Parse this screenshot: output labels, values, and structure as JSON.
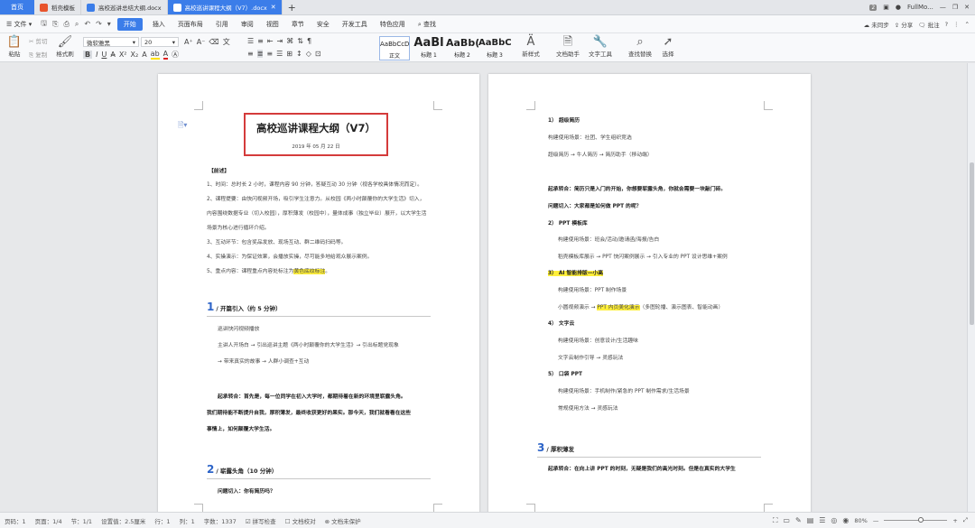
{
  "tabs": {
    "home": "首页",
    "t1": "稻壳模板",
    "t2": "高校巡讲总结大纲.docx",
    "t3": "高校巡讲课程大纲（V7）.docx",
    "badge": "2",
    "user": "FullMo..."
  },
  "menu": {
    "file": "文件",
    "start": "开始",
    "items": [
      "插入",
      "页面布局",
      "引用",
      "审阅",
      "视图",
      "章节",
      "安全",
      "开发工具",
      "特色应用"
    ],
    "search": "查找",
    "unsync": "未同步",
    "share": "分享",
    "comment": "批注"
  },
  "ribbon": {
    "paste": "粘贴",
    "cut": "剪切",
    "copy": "复制",
    "format_painter": "格式刷",
    "font": "微软雅黑",
    "size": "20",
    "styles": [
      {
        "preview": "AaBbCcDd",
        "name": "正文"
      },
      {
        "preview": "AaBl",
        "name": "标题 1"
      },
      {
        "preview": "AaBb(",
        "name": "标题 2"
      },
      {
        "preview": "AaBbC",
        "name": "标题 3"
      }
    ],
    "new_style": "新样式",
    "doc_helper": "文档助手",
    "text_tools": "文字工具",
    "find_replace": "查找替换",
    "select": "选择"
  },
  "page1": {
    "title": "高校巡讲课程大纲（V7）",
    "date": "2019 年 05 月 22 日",
    "note_head": "【前述】",
    "notes": [
      "1、时间：总时长 2 小时，课程内容 90 分钟，答疑互动 30 分钟（视各学校具体情况而定）。",
      "2、课程提要：由快闪视频开场，吸引学生注意力。从校园《两小时颠覆你的大学生活》切入，",
      "内容围绕数据专业（切入校园），厚积薄发（校园中），量体成事（独立毕业）展开，以大学生活",
      "场景为核心进行循环介绍。",
      "3、互动环节：包含奖品发放、现场互动、群二维码扫码等。",
      "4、实操演示：为保证效果，会播放实操，尽可能多地给观众展示案例。",
      "5、重点内容：课程重点内容处标注为"
    ],
    "notes_hl": "黄色底纹标注",
    "notes_end": "。",
    "sec1_num": "1",
    "sec1_title": "/ 开篇引入（约 5 分钟）",
    "sec1_lines": [
      "巡讲快闪视频播放",
      "主讲人开场白 → 引出巡讲主题《两小时颠覆你的大学生活》→ 引出标题党现象",
      "→ 带来真实的故事 → 人群小调查+互动"
    ],
    "trans1": [
      "起承转合：首先是，每一位同学在初入大学时，都期待着在新的环境里崭露头角。",
      "我们期待能不断提升自我，厚积薄发，最终收获更好的果实。那今天，我们就看看在这些",
      "事情上，如何颠覆大学生活。"
    ],
    "sec2_num": "2",
    "sec2_title": "/ 崭露头角（10 分钟）",
    "sec2_line": "问题切入：你有简历吗？"
  },
  "page2": {
    "items": [
      {
        "t": "1） 超级简历",
        "b": true
      },
      {
        "t": "构建使用场景：社团、学生组织竞选"
      },
      {
        "t": "超级简历 → 牛人简历 → 简历助手（移动端）"
      },
      {
        "t": "起承转合：简历只是入门的开始，你想要崭露头角，你就会需要一块敲门砖。",
        "b": true,
        "gap": true
      },
      {
        "t": "问题切入：大家都是如何做 PPT 的呢？",
        "b": true
      },
      {
        "t": "2） PPT 模板库",
        "b": true
      },
      {
        "t": "构建使用场景：班会/活动/邀请函/海报/告白",
        "i": 1
      },
      {
        "t": "稻壳模板库展示 → PPT 快闪案例展示 → 引入专业的 PPT 设计思维+案例",
        "i": 1
      },
      {
        "t": "3） AI 智能排版—小高",
        "b": true,
        "hl": true
      },
      {
        "t": "构建使用场景：PPT 制作场景",
        "i": 1
      },
      {
        "t": "小圆视频演示 → ",
        "i": 1,
        "hl2": "PPT 内页美化演示",
        "after": "（多图轮播、演示图表、智能动画）"
      },
      {
        "t": "4） 文字云",
        "b": true
      },
      {
        "t": "构建使用场景：创意设计/生活趣味",
        "i": 1
      },
      {
        "t": "文字云制作引导 → 灵感玩法",
        "i": 1
      },
      {
        "t": "5） 口袋 PPT",
        "b": true
      },
      {
        "t": "构建使用场景：手机制作/紧急的 PPT 制作需求/生活场景",
        "i": 1
      },
      {
        "t": "常规使用方法 → 灵感玩法",
        "i": 1
      }
    ],
    "sec3_num": "3",
    "sec3_title": "/ 厚积薄发",
    "trans3": "起承转合：在向上讲 PPT 的时刻，无疑是我们的高光时刻。但是在真实的大学生"
  },
  "status": {
    "page": "页码：1",
    "pages": "页面：1/4",
    "section": "节：1/1",
    "setting": "设置值：2.5厘米",
    "line": "行：1",
    "col": "列：1",
    "words": "字数：1337",
    "spell": "拼写检查",
    "proof": "文档校对",
    "protect": "文档未保护",
    "zoom": "80%"
  }
}
